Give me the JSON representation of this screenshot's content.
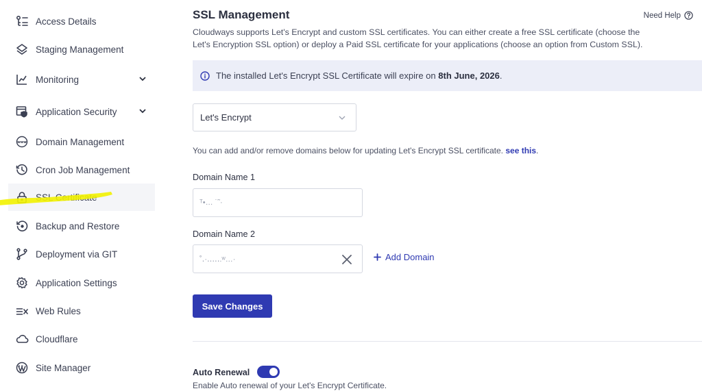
{
  "sidebar": {
    "items": [
      {
        "label": "Access Details",
        "icon": "access-details-icon"
      },
      {
        "label": "Staging Management",
        "icon": "layers-icon"
      },
      {
        "label": "Monitoring",
        "icon": "chart-line-icon",
        "expandable": true
      },
      {
        "label": "Application Security",
        "icon": "shield-window-icon",
        "expandable": true
      },
      {
        "label": "Domain Management",
        "icon": "www-globe-icon"
      },
      {
        "label": "Cron Job Management",
        "icon": "history-clock-icon"
      },
      {
        "label": "SSL Certificate",
        "icon": "lock-icon",
        "active": true
      },
      {
        "label": "Backup and Restore",
        "icon": "backup-icon"
      },
      {
        "label": "Deployment via GIT",
        "icon": "git-branch-icon"
      },
      {
        "label": "Application Settings",
        "icon": "gear-icon"
      },
      {
        "label": "Web Rules",
        "icon": "web-rules-icon"
      },
      {
        "label": "Cloudflare",
        "icon": "cloud-icon"
      },
      {
        "label": "Site Manager",
        "icon": "wordpress-icon"
      }
    ],
    "highlight_color": "#f2f200"
  },
  "main": {
    "title": "SSL Management",
    "need_help": "Need Help",
    "description": "Cloudways supports Let's Encrypt and custom SSL certificates. You can either create a free SSL certificate (choose the Let's Encryption SSL option) or deploy a Paid SSL certificate for your applications (choose an option from Custom SSL).",
    "banner": {
      "text_before": "The installed Let's Encrypt SSL Certificate will expire on ",
      "date": "8th June, 2026",
      "text_after": "."
    },
    "ssl_type_select": "Let's Encrypt",
    "hint_text": "You can add and/or remove domains below for updating Let's Encrypt SSL certificate. ",
    "hint_link": "see this",
    "hint_end": ".",
    "domain1_label": "Domain Name 1",
    "domain1_value": "ᵀ•… ˙˜·",
    "domain2_label": "Domain Name 2",
    "domain2_value": "˚․·․․․․․.ʷ…·",
    "add_domain": "Add Domain",
    "save_button": "Save Changes",
    "auto_renewal_label": "Auto Renewal",
    "auto_renewal_on": true,
    "auto_renewal_desc": "Enable Auto renewal of your Let's Encrypt Certificate."
  },
  "colors": {
    "accent": "#2f3ab2",
    "banner_bg": "#eceef8",
    "text": "#3a3f52"
  }
}
